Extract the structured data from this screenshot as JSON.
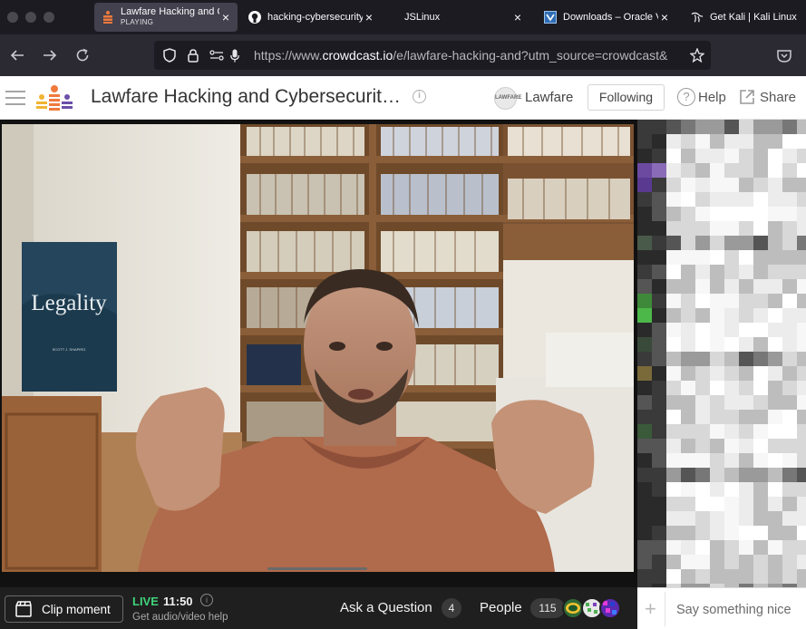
{
  "tabs": [
    {
      "title": "Lawfare Hacking and Cybersecurity",
      "status": "PLAYING",
      "icon": "crowdcast-logo-icon",
      "active": true
    },
    {
      "title": "hacking-cybersecurity",
      "icon": "github-icon"
    },
    {
      "title": "JSLinux",
      "icon": "none"
    },
    {
      "title": "Downloads – Oracle VM VirtualBox",
      "icon": "virtualbox-icon"
    },
    {
      "title": "Get Kali | Kali Linux",
      "icon": "kali-dragon-icon"
    }
  ],
  "address_bar": {
    "url_prefix": "https://www.",
    "url_domain": "crowdcast.io",
    "url_rest": "/e/lawfare-hacking-and?utm_source=crowdcast&"
  },
  "header": {
    "event_title": "Lawfare Hacking and Cybersecurit…",
    "org_avatar": "LAWFARE",
    "org_name": "Lawfare",
    "follow_label": "Following",
    "help_label": "Help",
    "share_label": "Share"
  },
  "video": {
    "book_title": "Legality",
    "book_author": "SCOTT J. SHAPIRO"
  },
  "bottom_bar": {
    "clip_label": "Clip moment",
    "live_label": "LIVE",
    "live_time": "11:50",
    "help_sub": "Get audio/video help",
    "ask_label": "Ask a Question",
    "ask_count": "4",
    "people_label": "People",
    "people_count": "115"
  },
  "chat": {
    "placeholder": "Say something nice"
  },
  "colors": {
    "live_green": "#3fd37b",
    "tab_bg": "#1c1b22",
    "nav_bg": "#2b2a33",
    "logo_orange": "#f07a3c",
    "logo_purple": "#6b4fa8"
  }
}
